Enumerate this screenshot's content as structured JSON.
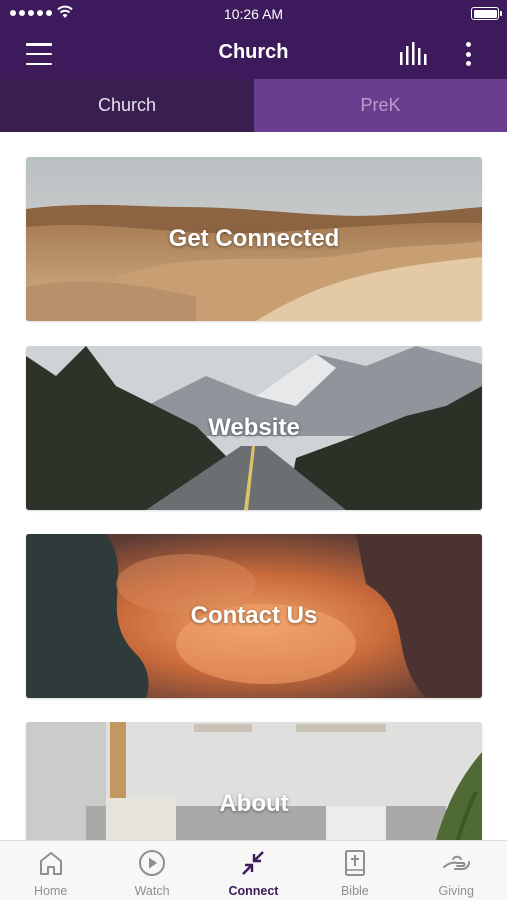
{
  "status_bar": {
    "time": "10:26 AM"
  },
  "nav": {
    "title": "Church",
    "menu_icon": "hamburger-menu-icon",
    "audio_icon": "audio-bars-icon",
    "more_icon": "more-vertical-icon"
  },
  "tabs": [
    {
      "label": "Church",
      "active": true
    },
    {
      "label": "PreK",
      "active": false
    }
  ],
  "cards": [
    {
      "label": "Get Connected",
      "image": "desert-dunes"
    },
    {
      "label": "Website",
      "image": "mountain-road-forest"
    },
    {
      "label": "Contact Us",
      "image": "orange-smoke-clouds"
    },
    {
      "label": "About",
      "image": "living-room-plants"
    }
  ],
  "tabbar": {
    "items": [
      {
        "label": "Home",
        "icon": "home-icon",
        "active": false
      },
      {
        "label": "Watch",
        "icon": "play-circle-icon",
        "active": false
      },
      {
        "label": "Connect",
        "icon": "connect-arrows-icon",
        "active": true
      },
      {
        "label": "Bible",
        "icon": "bible-icon",
        "active": false
      },
      {
        "label": "Giving",
        "icon": "giving-hand-icon",
        "active": false
      }
    ]
  },
  "colors": {
    "primary": "#3d1a5b",
    "tab_active_bg": "#3a1e4f",
    "tab_inactive_bg": "#6b3d8f",
    "tabbar_inactive": "#8e8e93"
  }
}
